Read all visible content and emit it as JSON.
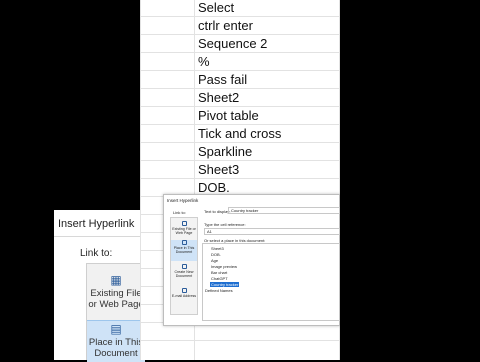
{
  "background_dialog": {
    "title": "Insert Hyperlink",
    "link_to_label": "Link to:",
    "items": [
      {
        "label": "Existing File or Web Page",
        "icon": "globe-file-icon"
      },
      {
        "label": "Place in This Document",
        "icon": "document-icon"
      }
    ]
  },
  "sheet": {
    "rows": [
      "Select",
      "ctrlr enter",
      "Sequence 2",
      "%",
      "Pass fail",
      "Sheet2",
      "Pivot table",
      "Tick and cross",
      "Sparkline",
      "Sheet3",
      "DOB."
    ]
  },
  "dialog": {
    "title": "Insert Hyperlink",
    "link_to_label": "Link to:",
    "left_items": [
      {
        "label": "Existing File or Web Page",
        "icon": "globe-file-icon"
      },
      {
        "label": "Place in This Document",
        "icon": "document-icon"
      },
      {
        "label": "Create New Document",
        "icon": "new-document-icon"
      },
      {
        "label": "E-mail Address",
        "icon": "email-icon"
      }
    ],
    "text_to_display_label": "Text to display:",
    "text_to_display_value": "Country tracker",
    "cell_reference_label": "Type the cell reference:",
    "cell_reference_value": "A1",
    "select_place_label": "Or select a place in this document:",
    "tree_items": [
      "Sheet3",
      "DOB.",
      "Age",
      "Image preview",
      "Bar chart",
      "ChatGPT",
      "Country tracker",
      "Defined Names"
    ],
    "selected_item": "Country tracker"
  },
  "colors": {
    "selection": "#1f6fd1",
    "selected_nav": "#cfe3f7"
  }
}
